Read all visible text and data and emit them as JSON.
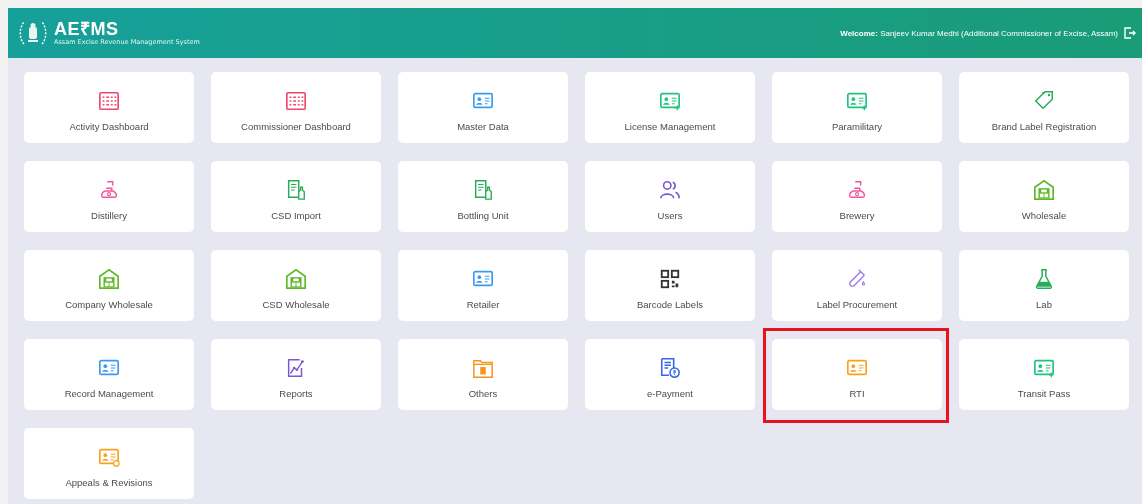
{
  "header": {
    "logo_text": "AE₹MS",
    "logo_subtitle": "Assam Excise Revenue Management System",
    "welcome_label": "Welcome:",
    "welcome_user": "Sanjeev Kumar Medhi (Additional Commissioner of Excise, Assam)"
  },
  "tiles": [
    {
      "label": "Activity Dashboard",
      "kind": "dashboard",
      "color": "#f0466e",
      "highlighted": false
    },
    {
      "label": "Commissioner Dashboard",
      "kind": "dashboard",
      "color": "#f0466e",
      "highlighted": false
    },
    {
      "label": "Master Data",
      "kind": "idcard",
      "color": "#3a9af0",
      "highlighted": false
    },
    {
      "label": "License Management",
      "kind": "idcard-plus",
      "color": "#1fc27e",
      "highlighted": false
    },
    {
      "label": "Paramilitary",
      "kind": "idcard-plus",
      "color": "#1fc27e",
      "highlighted": false
    },
    {
      "label": "Brand Label Registration",
      "kind": "tag",
      "color": "#2aab5a",
      "highlighted": false
    },
    {
      "label": "Distillery",
      "kind": "still",
      "color": "#f0589a",
      "highlighted": false
    },
    {
      "label": "CSD Import",
      "kind": "doc-bottle",
      "color": "#2aab5a",
      "highlighted": false
    },
    {
      "label": "Bottling Unit",
      "kind": "doc-bottle",
      "color": "#2aab5a",
      "highlighted": false
    },
    {
      "label": "Users",
      "kind": "users",
      "color": "#7b57d6",
      "highlighted": false
    },
    {
      "label": "Brewery",
      "kind": "still",
      "color": "#f0589a",
      "highlighted": false
    },
    {
      "label": "Wholesale",
      "kind": "warehouse",
      "color": "#5fb82a",
      "highlighted": false
    },
    {
      "label": "Company Wholesale",
      "kind": "warehouse",
      "color": "#5fb82a",
      "highlighted": false
    },
    {
      "label": "CSD Wholesale",
      "kind": "warehouse",
      "color": "#5fb82a",
      "highlighted": false
    },
    {
      "label": "Retailer",
      "kind": "idcard",
      "color": "#3a9af0",
      "highlighted": false
    },
    {
      "label": "Barcode Labels",
      "kind": "qr",
      "color": "#333333",
      "highlighted": false
    },
    {
      "label": "Label Procurement",
      "kind": "tube",
      "color": "#9a7ce0",
      "highlighted": false
    },
    {
      "label": "Lab",
      "kind": "flask",
      "color": "#2aab5a",
      "highlighted": false
    },
    {
      "label": "Record Management",
      "kind": "idcard",
      "color": "#3a9af0",
      "highlighted": false
    },
    {
      "label": "Reports",
      "kind": "chart-doc",
      "color": "#7b57d6",
      "highlighted": false
    },
    {
      "label": "Others",
      "kind": "folder",
      "color": "#f7941d",
      "highlighted": false
    },
    {
      "label": "e-Payment",
      "kind": "payment",
      "color": "#3466e8",
      "highlighted": false
    },
    {
      "label": "RTI",
      "kind": "idcard",
      "color": "#f7a21d",
      "highlighted": true
    },
    {
      "label": "Transit Pass",
      "kind": "idcard-plus",
      "color": "#1fc27e",
      "highlighted": false
    },
    {
      "label": "Appeals & Revisions",
      "kind": "idcard-badge",
      "color": "#f7a21d",
      "highlighted": false
    }
  ]
}
